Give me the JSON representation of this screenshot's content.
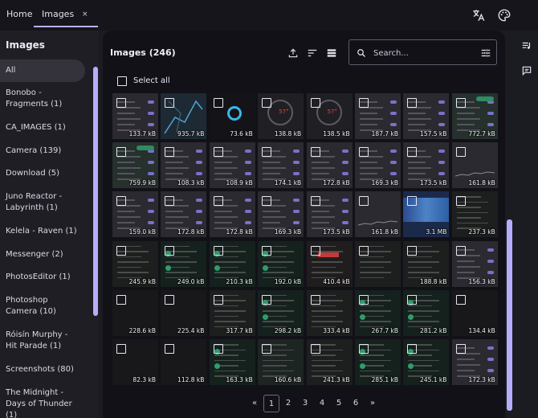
{
  "tabs": [
    {
      "label": "Home"
    },
    {
      "label": "Images",
      "close": "×"
    }
  ],
  "topbar_icons": [
    "translate-icon",
    "palette-icon"
  ],
  "right_rail_icons": [
    "playlist-icon",
    "comment-icon"
  ],
  "sidebar": {
    "title": "Images",
    "items": [
      {
        "label": "All"
      },
      {
        "label": "Bonobo - Fragments (1)"
      },
      {
        "label": "CA_IMAGES (1)"
      },
      {
        "label": "Camera (139)"
      },
      {
        "label": "Download (5)"
      },
      {
        "label": "Juno Reactor - Labyrinth (1)"
      },
      {
        "label": "Kelela - Raven (1)"
      },
      {
        "label": "Messenger (2)"
      },
      {
        "label": "PhotosEditor (1)"
      },
      {
        "label": "Photoshop Camera (10)"
      },
      {
        "label": "Róisín Murphy - Hit Parade (1)"
      },
      {
        "label": "Screenshots (80)"
      },
      {
        "label": "The Midnight - Days of Thunder (1)"
      }
    ]
  },
  "main": {
    "title": "Images (246)",
    "toolbar_icons": [
      "upload-icon",
      "sort-icon",
      "list-view-icon"
    ],
    "search": {
      "placeholder": "Search...",
      "value": ""
    },
    "select_all_label": "Select all",
    "thumbnails": [
      {
        "size": "133.7 kB",
        "style": "settings"
      },
      {
        "size": "935.7 kB",
        "style": "map"
      },
      {
        "size": "73.6 kB",
        "style": "ring"
      },
      {
        "size": "138.8 kB",
        "style": "compass"
      },
      {
        "size": "138.5 kB",
        "style": "compass"
      },
      {
        "size": "187.7 kB",
        "style": "settings"
      },
      {
        "size": "157.5 kB",
        "style": "settings"
      },
      {
        "size": "772.7 kB",
        "style": "settings-green"
      },
      {
        "size": "759.9 kB",
        "style": "settings-green"
      },
      {
        "size": "108.3 kB",
        "style": "settings"
      },
      {
        "size": "108.9 kB",
        "style": "settings"
      },
      {
        "size": "174.1 kB",
        "style": "settings"
      },
      {
        "size": "172.8 kB",
        "style": "settings"
      },
      {
        "size": "169.3 kB",
        "style": "settings"
      },
      {
        "size": "173.5 kB",
        "style": "settings"
      },
      {
        "size": "161.8 kB",
        "style": "chart"
      },
      {
        "size": "159.0 kB",
        "style": "settings"
      },
      {
        "size": "172.8 kB",
        "style": "settings"
      },
      {
        "size": "172.8 kB",
        "style": "settings"
      },
      {
        "size": "169.3 kB",
        "style": "settings"
      },
      {
        "size": "173.5 kB",
        "style": "settings"
      },
      {
        "size": "161.8 kB",
        "style": "chart"
      },
      {
        "size": "3.1 MB",
        "style": "photo"
      },
      {
        "size": "237.3 kB",
        "style": "text"
      },
      {
        "size": "245.9 kB",
        "style": "text"
      },
      {
        "size": "249.0 kB",
        "style": "chat"
      },
      {
        "size": "210.3 kB",
        "style": "chat"
      },
      {
        "size": "192.0 kB",
        "style": "chat"
      },
      {
        "size": "410.4 kB",
        "style": "text-red"
      },
      {
        "size": "",
        "style": "text"
      },
      {
        "size": "188.8 kB",
        "style": "text"
      },
      {
        "size": "156.3 kB",
        "style": "settings"
      },
      {
        "size": "228.6 kB",
        "style": "dark"
      },
      {
        "size": "225.4 kB",
        "style": "dark"
      },
      {
        "size": "317.7 kB",
        "style": "text"
      },
      {
        "size": "298.2 kB",
        "style": "chat"
      },
      {
        "size": "333.4 kB",
        "style": "text"
      },
      {
        "size": "267.7 kB",
        "style": "chat"
      },
      {
        "size": "281.2 kB",
        "style": "chat"
      },
      {
        "size": "134.4 kB",
        "style": "dark"
      },
      {
        "size": "82.3 kB",
        "style": "dark"
      },
      {
        "size": "112.8 kB",
        "style": "dark"
      },
      {
        "size": "163.3 kB",
        "style": "chat"
      },
      {
        "size": "160.6 kB",
        "style": "text-teal"
      },
      {
        "size": "241.3 kB",
        "style": "text"
      },
      {
        "size": "285.1 kB",
        "style": "chat"
      },
      {
        "size": "245.1 kB",
        "style": "chat"
      },
      {
        "size": "172.3 kB",
        "style": "settings"
      }
    ],
    "pagination": {
      "prev": "«",
      "pages": [
        "1",
        "2",
        "3",
        "4",
        "5",
        "6"
      ],
      "current": "1",
      "next": "»"
    }
  },
  "colors": {
    "accent": "#b6aefa",
    "background": "#1b1b22",
    "panel": "#121118"
  }
}
